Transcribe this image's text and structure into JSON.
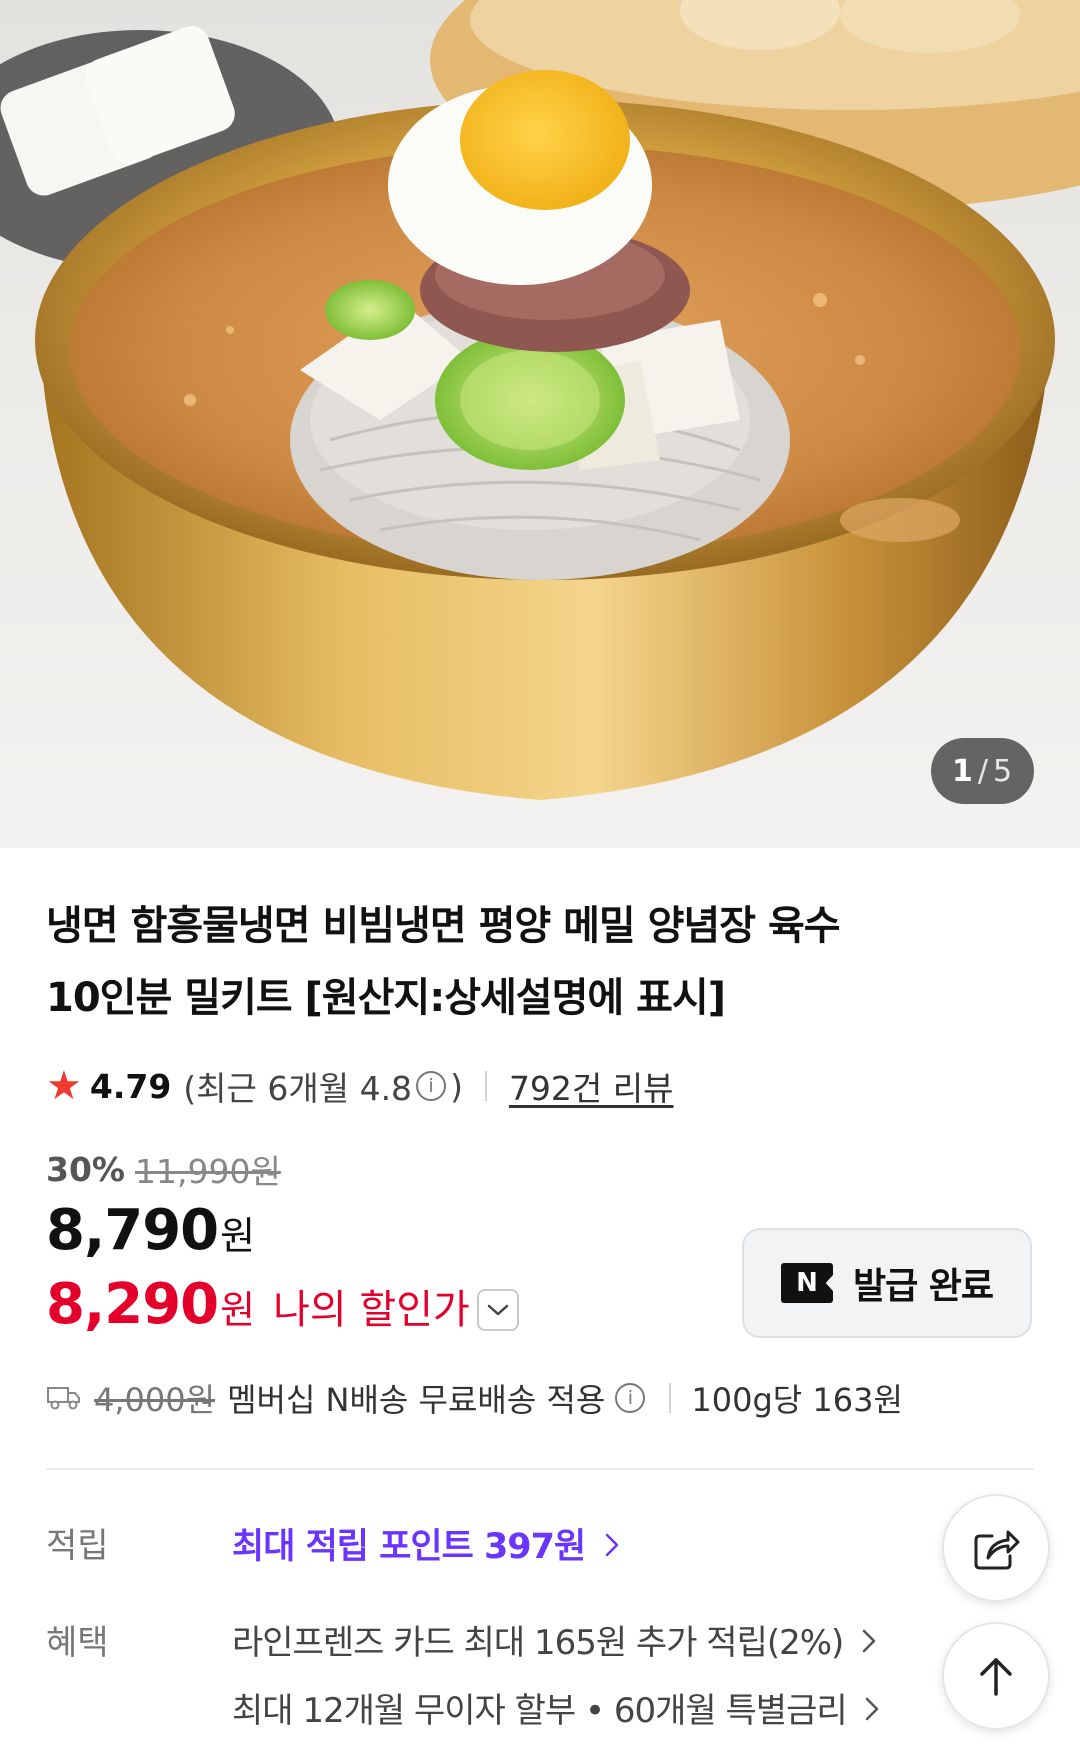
{
  "gallery": {
    "current": "1",
    "separator": "/",
    "total": "5"
  },
  "product": {
    "title_line1": "냉면 함흥물냉면 비빔냉면 평양 메밀 양념장 육수",
    "title_line2": "10인분 밀키트 [원산지:상세설명에 표시]"
  },
  "rating": {
    "score": "4.79",
    "recent_prefix": "(최근 6개월 4.8",
    "recent_suffix": ")",
    "reviews": "792건 리뷰"
  },
  "price": {
    "discount": "30%",
    "original": "11,990원",
    "sale_number": "8,790",
    "won": "원",
    "my_price_number": "8,290",
    "my_price_label": "나의 할인가"
  },
  "coupon": {
    "badge": "N",
    "label": "발급 완료"
  },
  "shipping": {
    "fee": "4,000원",
    "text": "멤버십 N배송 무료배송 적용",
    "unit_price": "100g당 163원"
  },
  "benefits": {
    "points_label": "적립",
    "points_value": "최대 적립 포인트 397원",
    "benefit_label": "혜택",
    "lines": [
      "라인프렌즈 카드 최대 165원 추가 적립(2%)",
      "최대 12개월 무이자 할부 • 60개월 특별금리"
    ]
  },
  "colors": {
    "sale_red": "#e4002b",
    "point_purple": "#6a35ff",
    "star": "#f0392f"
  },
  "icons": [
    "star-icon",
    "info-icon",
    "chevron-down-icon",
    "truck-icon",
    "chevron-right-icon",
    "share-icon",
    "arrow-up-icon"
  ]
}
